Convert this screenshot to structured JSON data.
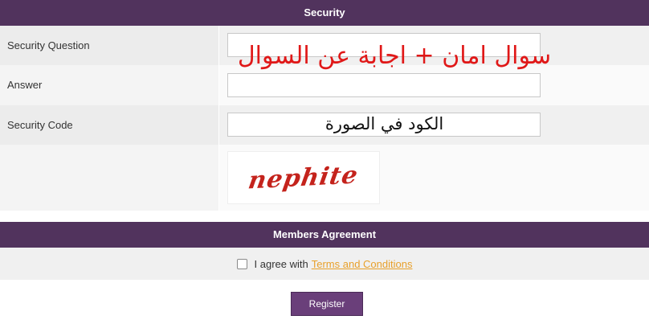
{
  "security": {
    "header": "Security",
    "question_label": "Security Question",
    "answer_label": "Answer",
    "code_label": "Security Code",
    "overlay_question_note": "سوال امان + اجابة عن السوال",
    "overlay_code_note": "الكود في الصورة",
    "captcha_text": "nephite",
    "question_value": "",
    "answer_value": "",
    "code_value": ""
  },
  "agreement": {
    "header": "Members Agreement",
    "agree_text": "I agree with",
    "terms_link": "Terms and Conditions",
    "checked": false
  },
  "actions": {
    "register_label": "Register"
  },
  "colors": {
    "header_bg": "#51335d",
    "link": "#e8a02a",
    "overlay_red": "#e01818",
    "button_bg": "#6a3f7a"
  }
}
